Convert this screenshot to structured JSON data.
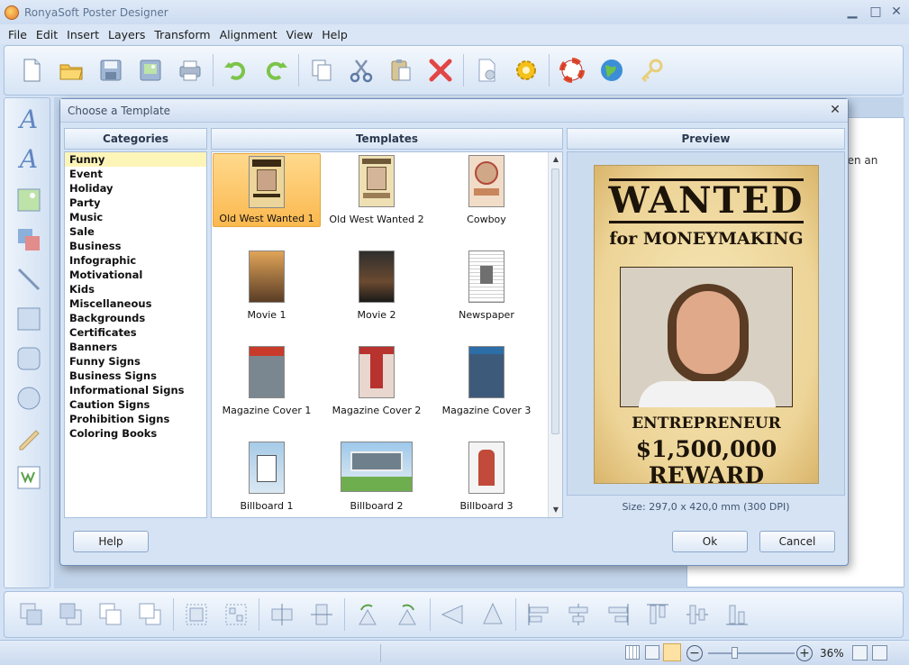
{
  "app": {
    "title": "RonyaSoft Poster Designer"
  },
  "menu": [
    "File",
    "Edit",
    "Insert",
    "Layers",
    "Transform",
    "Alignment",
    "View",
    "Help"
  ],
  "toolbar": {
    "icons": [
      "new-document-icon",
      "open-folder-icon",
      "save-icon",
      "save-as-image-icon",
      "print-icon",
      "undo-icon",
      "redo-icon",
      "copy-icon",
      "cut-icon",
      "paste-icon",
      "delete-icon",
      "page-setup-icon",
      "settings-icon",
      "help-icon",
      "website-icon",
      "key-icon"
    ]
  },
  "right_panel": {
    "text": "pen an"
  },
  "dialog": {
    "title": "Choose a Template",
    "categories_header": "Categories",
    "templates_header": "Templates",
    "preview_header": "Preview",
    "categories": [
      "Funny",
      "Event",
      "Holiday",
      "Party",
      "Music",
      "Sale",
      "Business",
      "Infographic",
      "Motivational",
      "Kids",
      "Miscellaneous",
      "Backgrounds",
      "Certificates",
      "Banners",
      "Funny Signs",
      "Business Signs",
      "Informational Signs",
      "Caution Signs",
      "Prohibition Signs",
      "Coloring Books"
    ],
    "selected_category": "Funny",
    "templates": [
      "Old West Wanted 1",
      "Old West Wanted 2",
      "Cowboy",
      "Movie 1",
      "Movie 2",
      "Newspaper",
      "Magazine Cover 1",
      "Magazine Cover 2",
      "Magazine Cover 3",
      "Billboard 1",
      "Billboard 2",
      "Billboard 3"
    ],
    "selected_template": "Old West Wanted 1",
    "poster": {
      "headline": "WANTED",
      "subhead": "for MONEYMAKING",
      "role": "ENTREPRENEUR",
      "reward": "$1,500,000 REWARD"
    },
    "size_text": "Size: 297,0 x 420,0 mm (300 DPI)",
    "buttons": {
      "help": "Help",
      "ok": "Ok",
      "cancel": "Cancel"
    }
  },
  "status": {
    "zoom": "36%"
  },
  "colors": {
    "accent": "#fbb84f",
    "selected_category": "#fdf4b8",
    "chrome": "#d3e2f4"
  }
}
